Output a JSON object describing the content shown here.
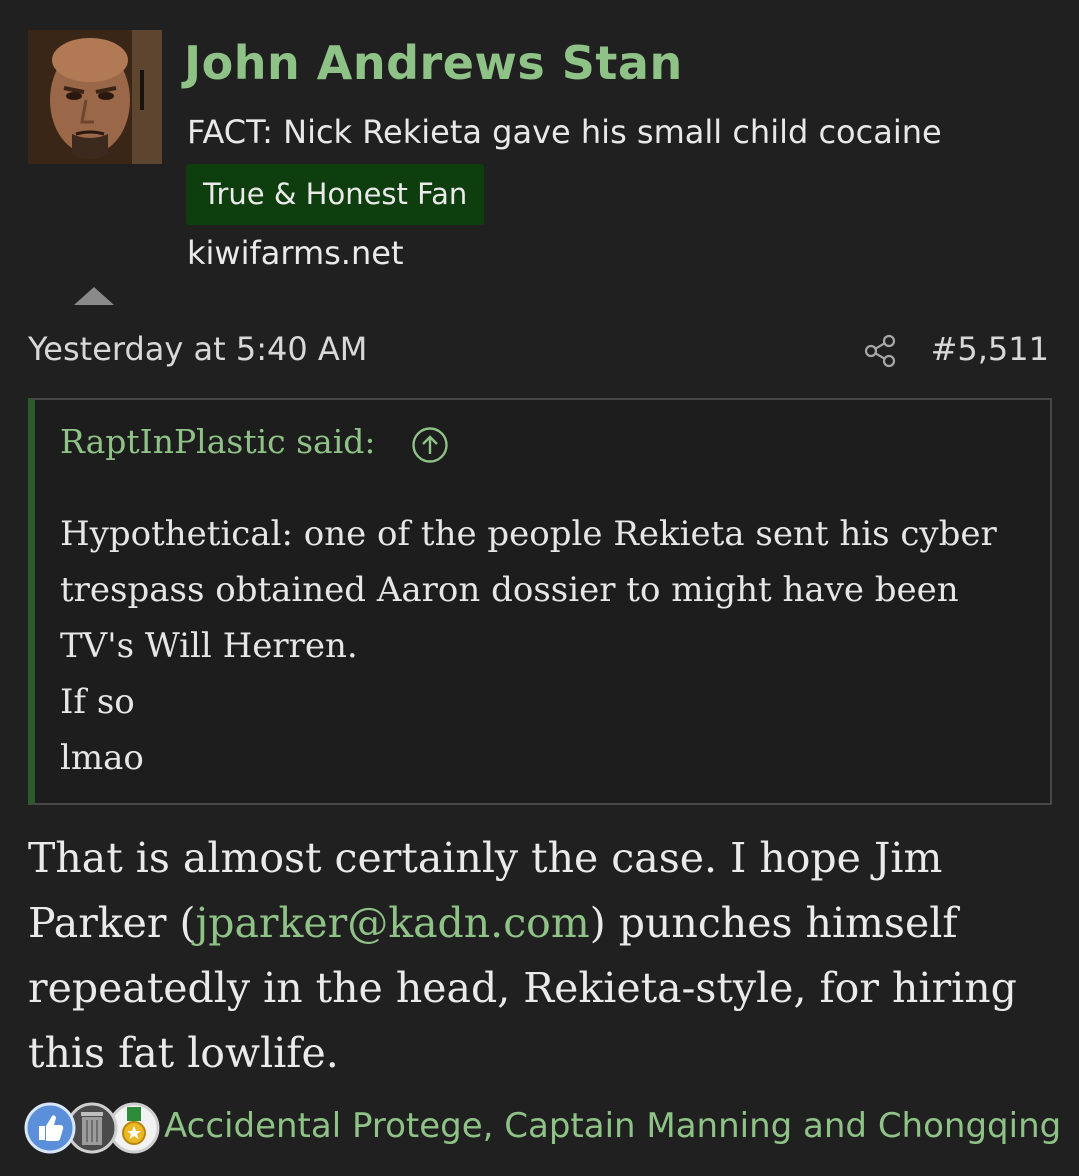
{
  "author": {
    "name": "John Andrews Stan",
    "user_title": "FACT: Nick Rekieta gave his small child cocaine",
    "banner": "True & Honest Fan",
    "site": "kiwifarms.net"
  },
  "post": {
    "date": "Yesterday at 5:40 AM",
    "number": "#5,511",
    "icons": {
      "share": "share-icon",
      "collapse": "triangle-up-icon"
    }
  },
  "quote": {
    "author_label": "RaptInPlastic said:",
    "lines": [
      "Hypothetical: one of the people Rekieta sent his cyber",
      "trespass obtained Aaron dossier to might have been",
      "TV's Will Herren.",
      "If so",
      "lmao"
    ],
    "icon": "arrow-up-circle-icon"
  },
  "message": {
    "before_link": "That is almost certainly the case. I hope Jim Parker (",
    "link": "jparker@kadn.com",
    "after_link": ") punches himself repeatedly in the head, Rekieta-style, for hiring this fat lowlife."
  },
  "reactions": {
    "icons": [
      "thumbs-up-icon",
      "trash-can-icon",
      "medal-icon"
    ],
    "users": "Accidental Protege, Captain Manning and Chongqing"
  },
  "colors": {
    "accent": "#8fc286",
    "banner_bg": "#0e3d0e",
    "background": "#202020",
    "quote_border": "#2d5a2d"
  }
}
